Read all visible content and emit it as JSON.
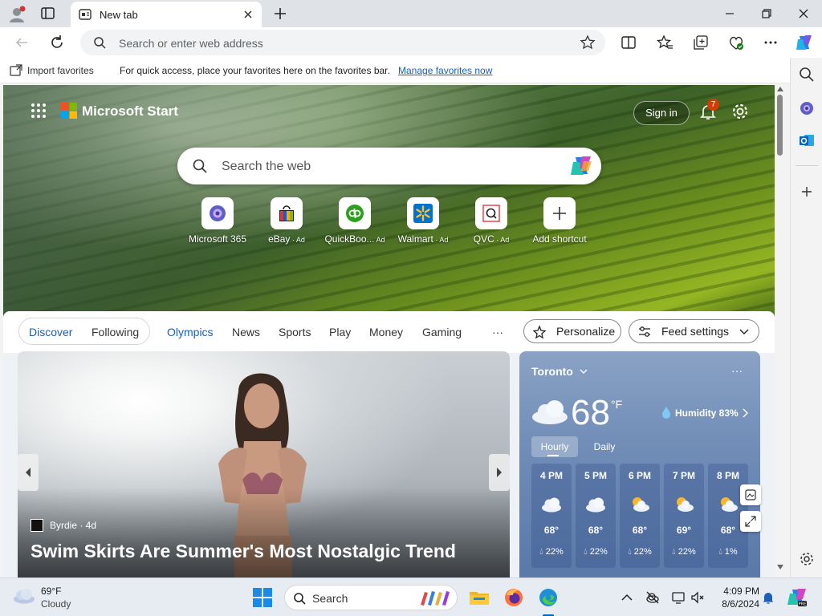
{
  "browser": {
    "tab_title": "New tab",
    "address_placeholder": "Search or enter web address"
  },
  "favorites_bar": {
    "import_label": "Import favorites",
    "message": "For quick access, place your favorites here on the favorites bar.",
    "manage_link": "Manage favorites now"
  },
  "start": {
    "brand": "Microsoft Start",
    "sign_in": "Sign in",
    "notification_count": "7",
    "search_placeholder": "Search the web",
    "shortcuts": [
      {
        "label": "Microsoft 365",
        "ad": ""
      },
      {
        "label": "eBay",
        "ad": " · Ad"
      },
      {
        "label": "QuickBoo...",
        "ad": " Ad"
      },
      {
        "label": "Walmart",
        "ad": " · Ad"
      },
      {
        "label": "QVC",
        "ad": " · Ad"
      },
      {
        "label": "Add shortcut",
        "ad": ""
      }
    ]
  },
  "feed_nav": {
    "tabs": [
      "Discover",
      "Following",
      "Olympics",
      "News",
      "Sports",
      "Play",
      "Money",
      "Gaming"
    ],
    "more": "···",
    "personalize": "Personalize",
    "feed_settings": "Feed settings"
  },
  "story": {
    "source": "Byrdie · 4d",
    "headline": "Swim Skirts Are Summer's Most Nostalgic Trend"
  },
  "weather": {
    "city": "Toronto",
    "more": "···",
    "temperature": "68",
    "unit": "°F",
    "humidity": "Humidity 83%",
    "tabs": [
      "Hourly",
      "Daily"
    ],
    "hours": [
      {
        "time": "4 PM",
        "temp": "68°",
        "precip": "22%",
        "icon": "cloud-icon"
      },
      {
        "time": "5 PM",
        "temp": "68°",
        "precip": "22%",
        "icon": "cloud-icon"
      },
      {
        "time": "6 PM",
        "temp": "68°",
        "precip": "22%",
        "icon": "partly-sunny-icon"
      },
      {
        "time": "7 PM",
        "temp": "69°",
        "precip": "22%",
        "icon": "partly-sunny-icon"
      },
      {
        "time": "8 PM",
        "temp": "68°",
        "precip": "1%",
        "icon": "partly-sunny-icon"
      }
    ]
  },
  "taskbar": {
    "weather_temp": "69°F",
    "weather_condition": "Cloudy",
    "search_label": "Search",
    "time": "4:09 PM",
    "date": "8/6/2024"
  },
  "colors": {
    "accent": "#0067c0",
    "link": "#1a5fb4",
    "notification": "#d83b01"
  }
}
